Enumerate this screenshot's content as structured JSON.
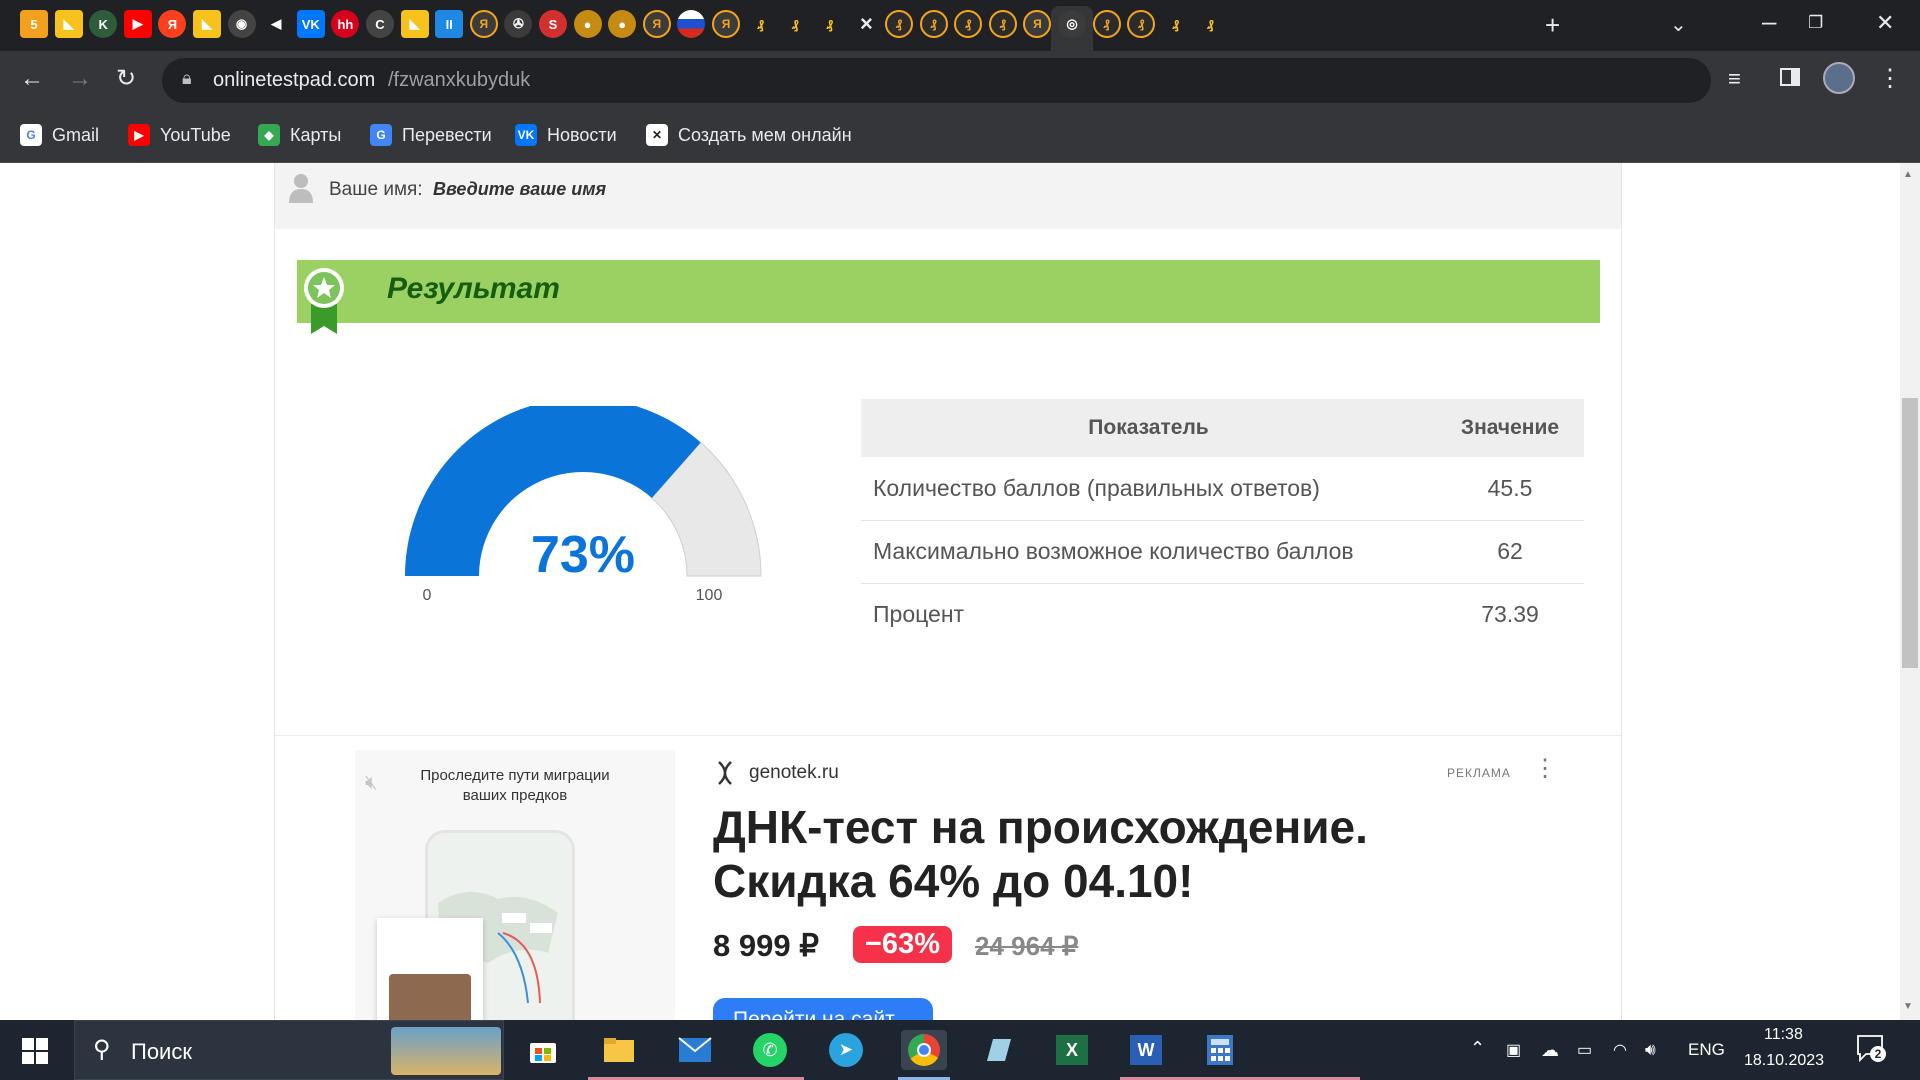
{
  "browser": {
    "url_domain": "onlinetestpad.com",
    "url_path": "/fzwanxkubyduk",
    "active_tab_close": "×",
    "new_tab": "+",
    "tabs": [
      {
        "icon": "mail-badge-icon",
        "glyph": "5",
        "bg": "#f2a01e"
      },
      {
        "icon": "kinopoisk-icon",
        "glyph": "◣",
        "bg": "#f8c21c"
      },
      {
        "icon": "k-icon",
        "glyph": "K",
        "bg": "#2f5d3c"
      },
      {
        "icon": "youtube-icon",
        "glyph": "▶",
        "bg": "#ff0000"
      },
      {
        "icon": "yandex-icon",
        "glyph": "Я",
        "bg": "#fc3f1d"
      },
      {
        "icon": "kinopoisk-icon",
        "glyph": "◣",
        "bg": "#f8c21c"
      },
      {
        "icon": "gamepad-icon",
        "glyph": "◉",
        "bg": "#444"
      },
      {
        "icon": "speaker-icon",
        "glyph": "◀",
        "bg": "#202124"
      },
      {
        "icon": "vk-icon",
        "glyph": "VK",
        "bg": "#0077ff"
      },
      {
        "icon": "hh-icon",
        "glyph": "hh",
        "bg": "#d6001c"
      },
      {
        "icon": "c-icon",
        "glyph": "C",
        "bg": "#444"
      },
      {
        "icon": "kinopoisk-icon",
        "glyph": "◣",
        "bg": "#f8c21c"
      },
      {
        "icon": "pause-icon",
        "glyph": "II",
        "bg": "#1e88e5"
      },
      {
        "icon": "yandex-ring-icon",
        "glyph": "Я",
        "bg": "#3b3b3b"
      },
      {
        "icon": "wheel-icon",
        "glyph": "✇",
        "bg": "#3b3b3b"
      },
      {
        "icon": "red-circle-icon",
        "glyph": "S",
        "bg": "#d32f2f"
      },
      {
        "icon": "gold-coin-icon",
        "glyph": "●",
        "bg": "#c58b12"
      },
      {
        "icon": "gold-coin-icon",
        "glyph": "●",
        "bg": "#c58b12"
      },
      {
        "icon": "yandex-ring-icon",
        "glyph": "Я",
        "bg": "#3b3b3b"
      },
      {
        "icon": "russia-flag-icon",
        "glyph": "",
        "bg": "#ffffff"
      },
      {
        "icon": "yandex-ring-icon",
        "glyph": "Я",
        "bg": "#3b3b3b"
      },
      {
        "icon": "yellow-swirl-icon",
        "glyph": "₰",
        "bg": "#202124"
      },
      {
        "icon": "yellow-swirl-icon",
        "glyph": "₰",
        "bg": "#202124"
      },
      {
        "icon": "yellow-swirl-icon",
        "glyph": "₰",
        "bg": "#202124"
      },
      {
        "icon": "active-tab-close-icon",
        "glyph": "",
        "bg": "transparent"
      },
      {
        "icon": "yellow-ring-icon",
        "glyph": "₰",
        "bg": "#2b2b2b"
      },
      {
        "icon": "yellow-ring-icon",
        "glyph": "₰",
        "bg": "#2b2b2b"
      },
      {
        "icon": "yellow-ring-icon",
        "glyph": "₰",
        "bg": "#2b2b2b"
      },
      {
        "icon": "yellow-ring-icon",
        "glyph": "₰",
        "bg": "#2b2b2b"
      },
      {
        "icon": "yandex-ring-icon",
        "glyph": "Я",
        "bg": "#3b3b3b"
      },
      {
        "icon": "target-icon",
        "glyph": "◎",
        "bg": "#3b3b3b"
      },
      {
        "icon": "yellow-ring-icon",
        "glyph": "₰",
        "bg": "#2b2b2b"
      },
      {
        "icon": "yellow-ring-icon",
        "glyph": "₰",
        "bg": "#2b2b2b"
      },
      {
        "icon": "yellow-swirl-icon",
        "glyph": "₰",
        "bg": "#202124"
      },
      {
        "icon": "yellow-swirl-icon",
        "glyph": "₰",
        "bg": "#202124"
      }
    ]
  },
  "bookmarks": [
    {
      "label": "Gmail",
      "icon": "google-icon",
      "glyph": "G",
      "bg": "#ffffff",
      "fg": "#4285f4"
    },
    {
      "label": "YouTube",
      "icon": "youtube-icon",
      "glyph": "▶",
      "bg": "#ff0000",
      "fg": "#fff"
    },
    {
      "label": "Карты",
      "icon": "maps-icon",
      "glyph": "◆",
      "bg": "#34a853",
      "fg": "#fff"
    },
    {
      "label": "Перевести",
      "icon": "translate-icon",
      "glyph": "G",
      "bg": "#4285f4",
      "fg": "#fff"
    },
    {
      "label": "Новости",
      "icon": "vk-icon",
      "glyph": "VK",
      "bg": "#0077ff",
      "fg": "#fff"
    },
    {
      "label": "Создать мем онлайн",
      "icon": "meme-icon",
      "glyph": "✕",
      "bg": "#ffffff",
      "fg": "#222"
    }
  ],
  "page": {
    "name_label": "Ваше имя:",
    "name_value": "Введите ваше имя",
    "result_title": "Результат",
    "gauge": {
      "value": 73,
      "label": "73%",
      "min_label": "0",
      "max_label": "100",
      "fill_color": "#0b74d8",
      "rest_color": "#e8e8e8"
    },
    "table": {
      "headers": [
        "Показатель",
        "Значение"
      ],
      "rows": [
        [
          "Количество баллов (правильных ответов)",
          "45.5"
        ],
        [
          "Максимально возможное количество баллов",
          "62"
        ],
        [
          "Процент",
          "73.39"
        ]
      ]
    },
    "ad": {
      "image_caption_line1": "Проследите пути миграции",
      "image_caption_line2": "ваших предков",
      "domain": "genotek.ru",
      "ad_label": "РЕКЛАМА",
      "headline_line1": "ДНК-тест на происхождение.",
      "headline_line2": "Скидка 64% до 04.10!",
      "price": "8 999 ₽",
      "discount": "−63%",
      "old_price": "24 964 ₽",
      "cta": "Перейти на сайт"
    }
  },
  "taskbar": {
    "search_placeholder": "Поиск",
    "language": "ENG",
    "time": "11:38",
    "date": "18.10.2023",
    "notifications": "2"
  }
}
